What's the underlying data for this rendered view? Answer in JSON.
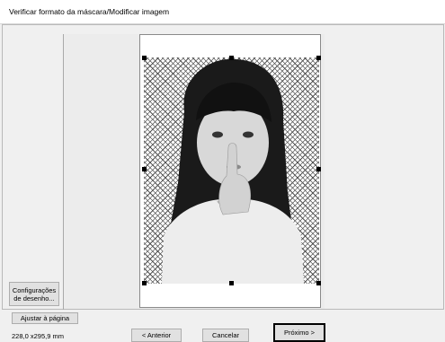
{
  "window": {
    "title": "Verificar formato da máscara/Modificar imagem"
  },
  "sidebar": {
    "settings_button_line1": "Configurações",
    "settings_button_line2": "de desenho..."
  },
  "toolbar": {
    "fit_page_label": "Ajustar à página",
    "size_readout": "228,0 x295,9 mm"
  },
  "footer": {
    "prev_label": "< Anterior",
    "cancel_label": "Cancelar",
    "next_label": "Próximo >"
  },
  "preview": {
    "image_subject": "Girl with finger on lips (black and white photo)",
    "mask_pattern": "crosshatch"
  },
  "colors": {
    "window_bg": "#f0f0f0",
    "titlebar_bg": "#ffffff",
    "button_bg": "#e1e1e1",
    "button_border": "#adadad",
    "mask_hatch": "#555555"
  }
}
